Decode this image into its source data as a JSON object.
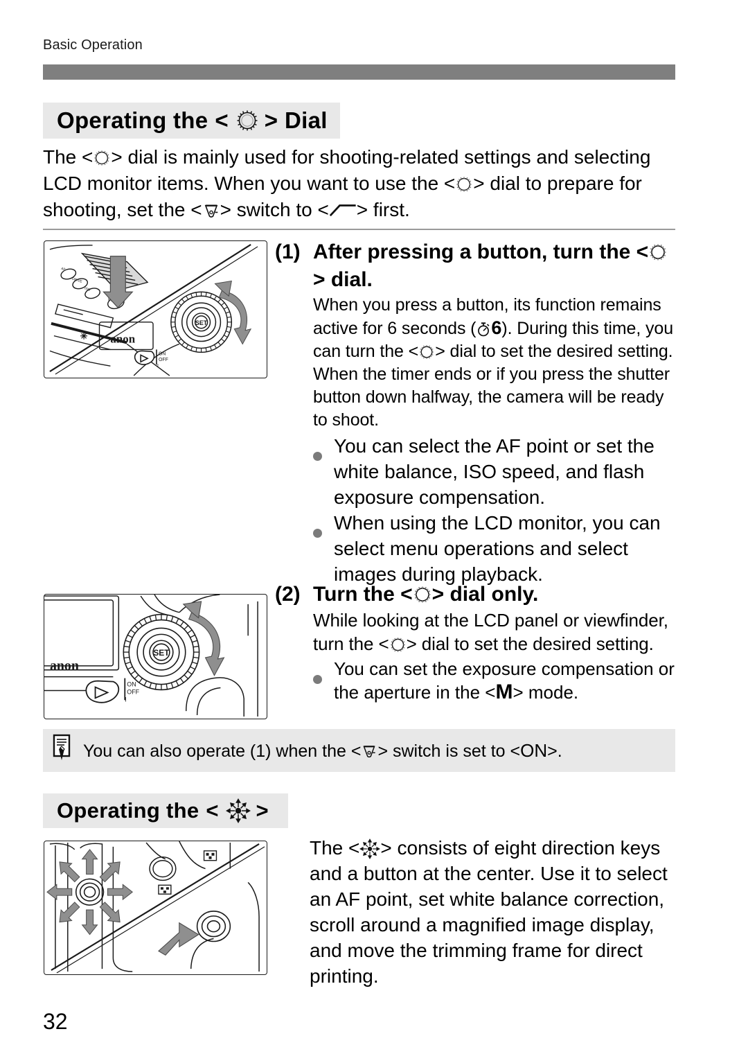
{
  "page": {
    "running_head": "Basic Operation",
    "number": "32"
  },
  "sections": [
    {
      "id": "dial",
      "heading_prefix": "Operating the",
      "heading_icon": "quick-control-dial-icon",
      "heading_suffix": "Dial",
      "intro": [
        "The <",
        "> dial is mainly used for shooting-related settings and selecting LCD monitor items. When you want to use the <",
        "> dial to prepare for shooting, set the <",
        "> switch to <",
        "> first."
      ],
      "intro_icons": [
        "quick-control-dial-icon",
        "quick-control-dial-icon",
        "main-switch-icon",
        "dial-on-slope-icon"
      ]
    },
    {
      "id": "multi",
      "heading_prefix": "Operating the",
      "heading_icon": "multi-controller-icon",
      "heading_suffix": ""
    }
  ],
  "steps": [
    {
      "number": "(1)",
      "title_a": "After pressing a button, turn the <",
      "title_icon": "quick-control-dial-icon",
      "title_b": "> dial.",
      "body_a": "When you press a button, its function remains active for 6 seconds (",
      "body_timer_icon": "self-timer-icon",
      "body_timer_value": "6",
      "body_b": "). During this time, you can turn the <",
      "body_dial_icon": "quick-control-dial-icon",
      "body_c": "> dial to set the desired setting. When the timer ends or if you press the shutter button down halfway, the camera will be ready to shoot.",
      "bullets": [
        "You can select the AF point or set the white balance, ISO speed, and flash exposure compensation.",
        "When using the LCD monitor, you can select menu operations and select images during playback."
      ]
    },
    {
      "number": "(2)",
      "title_a": "Turn the <",
      "title_icon": "quick-control-dial-icon",
      "title_b": "> dial only.",
      "body_a": "While looking at the LCD panel or viewfinder, turn the <",
      "body_dial_icon": "quick-control-dial-icon",
      "body_b": "> dial to set the desired setting.",
      "bullets_rich": [
        {
          "a": "You can set the exposure compensation or the aperture in the <",
          "icon_label": "M",
          "b": "> mode."
        }
      ]
    }
  ],
  "note": {
    "icon": "memo-note-icon",
    "text_a": "You can also operate (1) when the <",
    "text_icon": "main-switch-icon",
    "text_b": "> switch is set to <",
    "text_on": "ON",
    "text_c": ">."
  },
  "multi_paragraph": {
    "a": "The <",
    "icon": "multi-controller-icon",
    "b": "> consists of eight direction keys and a button at the center. Use it to select an AF point, set white balance correction, scroll around a magnified image display, and move the trimming frame for direct printing."
  },
  "figures": [
    {
      "name": "figure-press-button-turn-dial",
      "labels": [
        "SET",
        "ON",
        "OFF",
        "Canon"
      ]
    },
    {
      "name": "figure-turn-dial-only",
      "labels": [
        "SET",
        "ON",
        "OFF",
        "Canon"
      ]
    },
    {
      "name": "figure-multi-controller",
      "labels": []
    }
  ],
  "colors": {
    "head_bar": "#7f7f7f",
    "heading_chip": "#e8e8e8",
    "note_box": "#e8e8e8",
    "bullet_dot": "#7b7b7b",
    "arrow_gray": "#8a8a8a",
    "rule": "#9a9a9a"
  }
}
